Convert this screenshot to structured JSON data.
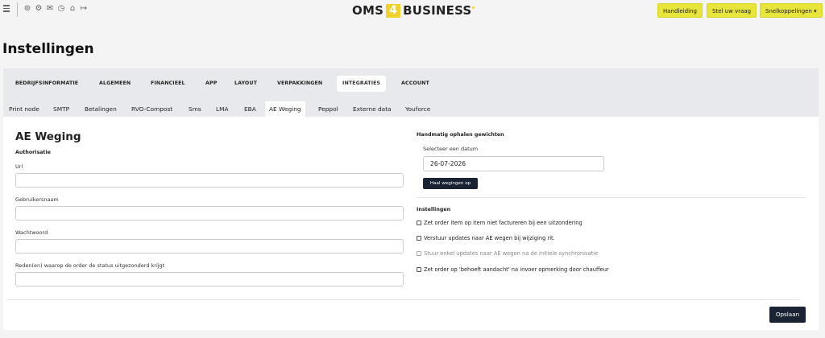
{
  "topbar": {
    "icons": [
      "user-icon",
      "gear-icon",
      "mail-icon",
      "clock-icon",
      "sitemap-icon",
      "logout-icon"
    ],
    "icon_glyphs": [
      "⊚",
      "⚙",
      "✉",
      "◷",
      "⌂",
      "↦"
    ],
    "logo": {
      "part1": "OMS",
      "part2": "4",
      "part3": "BUSINESS"
    },
    "buttons": [
      "Handleiding",
      "Stel uw vraag",
      "Snelkoppelingen ▾"
    ]
  },
  "page_title": "Instellingen",
  "main_tabs": [
    "BEDRIJFSINFORMATIE",
    "ALGEMEEN",
    "FINANCIEEL",
    "APP",
    "LAYOUT",
    "VERPAKKINGEN",
    "INTEGRATIES",
    "ACCOUNT"
  ],
  "active_main_tab": "INTEGRATIES",
  "sub_tabs": [
    "Print node",
    "SMTP",
    "Betalingen",
    "RVO-Compost",
    "Sms",
    "LMA",
    "EBA",
    "AE Weging",
    "Peppol",
    "Externe data",
    "Youforce"
  ],
  "active_sub_tab": "AE Weging",
  "section": {
    "title": "AE Weging",
    "auth_title": "Authorisatie",
    "fields": [
      {
        "label": "Url",
        "value": ""
      },
      {
        "label": "Gebruikersnaam",
        "value": ""
      },
      {
        "label": "Wachtwoord",
        "value": ""
      },
      {
        "label": "Reden(en) waarop de order de status uitgezonderd krijgt",
        "value": ""
      }
    ]
  },
  "manual": {
    "title": "Handmatig ophalen gewichten",
    "date_label": "Selecteer een datum",
    "date_value": "26-07-2026",
    "fetch_button": "Haal wegingen op"
  },
  "settings": {
    "title": "Instellingen",
    "options": [
      {
        "label": "Zet order item op item niet factureren bij een uitzondering",
        "checked": false,
        "disabled": false
      },
      {
        "label": "Verstuur updates naar AE wegen bij wijziging rit.",
        "checked": false,
        "disabled": false
      },
      {
        "label": "Stuur enkel updates naar AE wegen na de initiele synchronisatie",
        "checked": false,
        "disabled": true
      },
      {
        "label": "Zet order op 'behoeft aandacht' na invoer opmerking door chauffeur",
        "checked": false,
        "disabled": false
      }
    ]
  },
  "save_button": "Opslaan"
}
